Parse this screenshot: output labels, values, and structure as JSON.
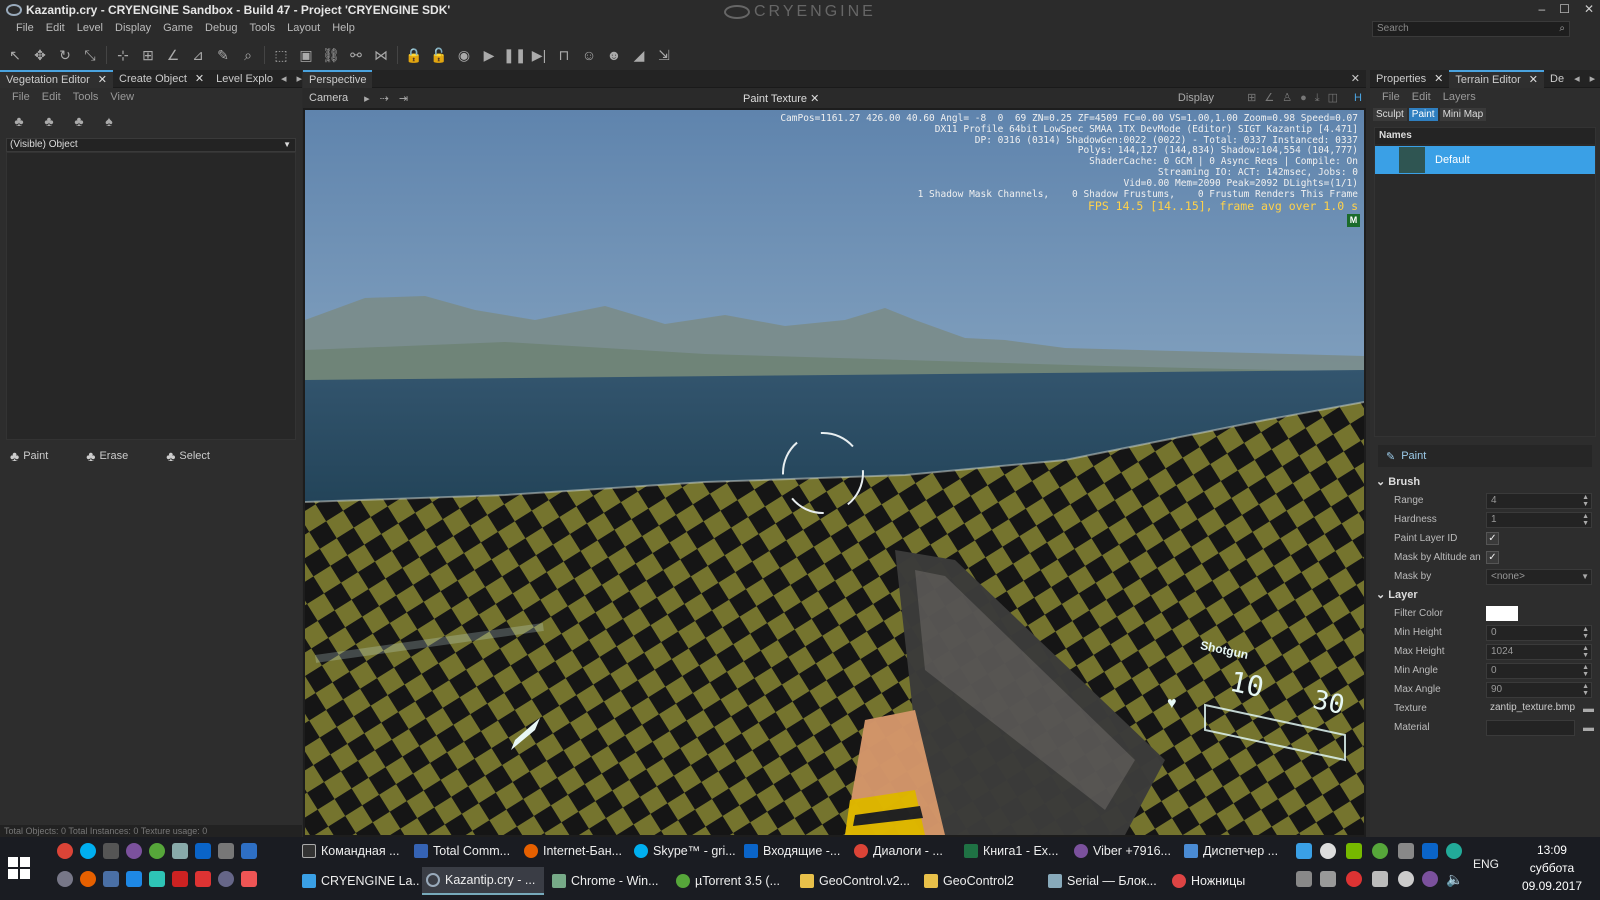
{
  "window": {
    "title": "Kazantip.cry - CRYENGINE Sandbox - Build 47 - Project 'CRYENGINE SDK'",
    "brand": "CRYENGINE",
    "min": "–",
    "max": "☐",
    "close": "✕"
  },
  "menu": [
    "File",
    "Edit",
    "Level",
    "Display",
    "Game",
    "Debug",
    "Tools",
    "Layout",
    "Help"
  ],
  "search": {
    "placeholder": "Search"
  },
  "left_panel": {
    "tabs": [
      {
        "label": "Vegetation Editor"
      },
      {
        "label": "Create Object"
      },
      {
        "label": "Level Explo"
      }
    ],
    "submenu": [
      "File",
      "Edit",
      "Tools",
      "View"
    ],
    "dropdown": "(Visible) Object",
    "tools": [
      "Paint",
      "Erase",
      "Select"
    ],
    "status": "Total Objects: 0  Total Instances: 0  Texture usage: 0"
  },
  "viewport": {
    "tab": "Perspective",
    "camera": "Camera",
    "center_tab": "Paint Texture",
    "display": "Display",
    "stats": [
      "CamPos=1161.27 426.00 40.60 Angl= -8  0  69 ZN=0.25 ZF=4509 FC=0.00 VS=1.00,1.00 Zoom=0.98 Speed=0.07",
      "DX11 Profile 64bit LowSpec SMAA 1TX DevMode (Editor) SIGT Kazantip [4.471]",
      "DP: 0316 (0314) ShadowGen:0022 (0022) - Total: 0337 Instanced: 0337",
      "Polys: 144,127 (144,834) Shadow:104,554 (104,777)",
      "ShaderCache: 0 GCM | 0 Async Reqs | Compile: On",
      "Streaming IO: ACT: 142msec, Jobs: 0",
      "Vid=0.00 Mem=2090 Peak=2092 DLights=(1/1)",
      "1 Shadow Mask Channels,    0 Shadow Frustums,    0 Frustum Renders This Frame"
    ],
    "fps": "FPS 14.5 [14..15], frame avg over 1.0 s",
    "badge": "M",
    "hud": {
      "weapon": "Shotgun",
      "ammo_left": "10",
      "ammo_right": "30"
    }
  },
  "right_panel": {
    "tabs": [
      {
        "label": "Properties"
      },
      {
        "label": "Terrain Editor"
      },
      {
        "label": "De"
      }
    ],
    "submenu": [
      "File",
      "Edit",
      "Layers"
    ],
    "modes": [
      "Sculpt",
      "Paint",
      "Mini Map"
    ],
    "names_header": "Names",
    "layer": "Default",
    "paint_button": "Paint",
    "brush_section": "Brush",
    "brush": [
      {
        "label": "Range",
        "value": "4"
      },
      {
        "label": "Hardness",
        "value": "1"
      }
    ],
    "paint_layer_id": "Paint Layer ID",
    "mask_by_altitude": "Mask by Altitude an",
    "mask_by": {
      "label": "Mask by",
      "value": "<none>"
    },
    "layer_section": "Layer",
    "filter_color": "Filter Color",
    "layer_props": [
      {
        "label": "Min Height",
        "value": "0"
      },
      {
        "label": "Max Height",
        "value": "1024"
      },
      {
        "label": "Min Angle",
        "value": "0"
      },
      {
        "label": "Max Angle",
        "value": "90"
      }
    ],
    "texture": {
      "label": "Texture",
      "value": "zantip_texture.bmp"
    },
    "material": {
      "label": "Material",
      "value": ""
    }
  },
  "taskbar": {
    "row1": [
      "Командная ...",
      "Total Comm...",
      "Internet-Бан...",
      "Skype™ - gri...",
      "Входящие -...",
      "Диалоги - ...",
      "Книга1 - Ex...",
      "Viber +7916...",
      "Диспетчер ..."
    ],
    "row2": [
      "CRYENGINE La...",
      "Kazantip.cry - ...",
      "Chrome - Win...",
      "µTorrent 3.5  (...",
      "GeoControl.v2...",
      "GeoControl2",
      "Serial — Блок...",
      "Ножницы"
    ],
    "lang": "ENG",
    "time": "13:09",
    "day": "суббота",
    "date": "09.09.2017"
  }
}
